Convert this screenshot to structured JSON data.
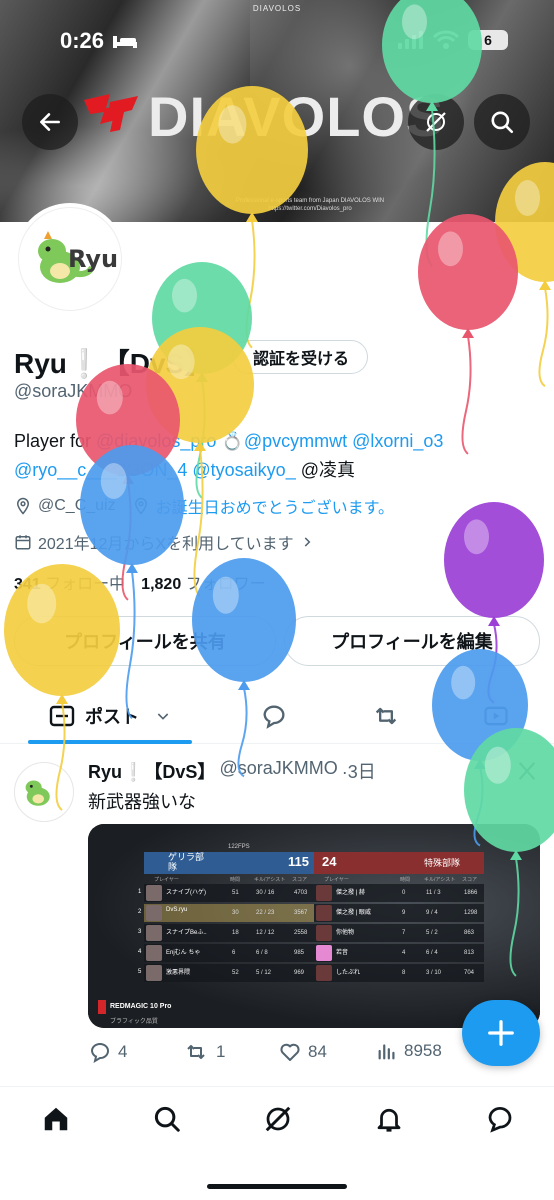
{
  "status_bar": {
    "time": "0:26",
    "battery": "6",
    "app_label": "DIAVOLOS"
  },
  "banner": {
    "brand": "DIAVOLOS",
    "tagline_1": "Professional e-sports team from Japan DIAVOLOS WIN",
    "tagline_2": "https://twitter.com/Diavolos_pro"
  },
  "profile": {
    "avatar_text": "Ryu",
    "name": "Ryu❕【DvS】",
    "verify_label": "認証を受ける",
    "handle": "@soraJKMMO",
    "bio": {
      "line1_prefix": "Player for ",
      "mention1": "@diavolos_pro",
      "ring": "💍",
      "mention2": "@pvcymmwt",
      "mention3": "@lxorni_o3",
      "mention4": "@ryo__c___2GON_4",
      "mention5": "@tyosaikyo_",
      "line2_suffix": "@凌真"
    },
    "location": "@C_C_uiz",
    "birthday": "お誕生日おめでとうございます。",
    "joined": "2021年12月からXを利用しています",
    "following_count": "341",
    "following_label": "フォロー中",
    "followers_count": "1,820",
    "followers_label": "フォロワー",
    "share_button": "プロフィールを共有",
    "edit_button": "プロフィールを編集"
  },
  "tabs": {
    "posts_label": "ポスト"
  },
  "post": {
    "author_name": "Ryu❕【DvS】",
    "author_handle": "@soraJKMMO",
    "time": "·3日",
    "text": "新武器強いな",
    "stats": {
      "replies": "4",
      "reposts": "1",
      "likes": "84",
      "views": "8958"
    },
    "media": {
      "team_left": "ゲリラ部隊",
      "team_left_score": "115",
      "team_right": "特殊部隊",
      "team_right_score": "24",
      "fps": "122FPS",
      "col_time": "時間",
      "col_ka": "キル/アシスト",
      "col_score": "スコア",
      "col_player": "プレイヤー",
      "left_rows": [
        {
          "rank": "1",
          "name": "スナイプ(ハゲ)",
          "time": "51",
          "ka": "30 / 16",
          "score": "4703"
        },
        {
          "rank": "2",
          "name": "DvS.ryu",
          "time": "30",
          "ka": "22 / 23",
          "score": "3567"
        },
        {
          "rank": "3",
          "name": "スナイプBeふ..",
          "time": "18",
          "ka": "12 / 12",
          "score": "2558"
        },
        {
          "rank": "4",
          "name": "Enjむん ちゃ",
          "time": "6",
          "ka": "6 / 8",
          "score": "985"
        },
        {
          "rank": "5",
          "name": "激悪界隈",
          "time": "52",
          "ka": "5 / 12",
          "score": "969"
        }
      ],
      "right_rows": [
        {
          "rank": "1",
          "name": "傑之撥 | 赫",
          "time": "0",
          "ka": "11 / 3",
          "score": "1866"
        },
        {
          "rank": "2",
          "name": "傑之撥 | 眼威",
          "time": "9",
          "ka": "9 / 4",
          "score": "1298"
        },
        {
          "rank": "3",
          "name": "你他物",
          "time": "7",
          "ka": "5 / 2",
          "score": "863"
        },
        {
          "rank": "4",
          "name": "若音",
          "time": "4",
          "ka": "6 / 4",
          "score": "813"
        },
        {
          "rank": "5",
          "name": "したぶれ",
          "time": "8",
          "ka": "3 / 10",
          "score": "704"
        }
      ],
      "watermark": "REDMAGIC 10 Pro",
      "watermark_sub": "ブラフィック品質"
    }
  },
  "colors": {
    "accent": "#1d9bf0",
    "text": "#0f1419",
    "muted": "#536471",
    "balloon_yellow": "#f3cd3f",
    "balloon_green": "#5fd9a3",
    "balloon_red": "#e8566e",
    "balloon_blue": "#4c9bee",
    "balloon_purple": "#9b3fd6"
  }
}
